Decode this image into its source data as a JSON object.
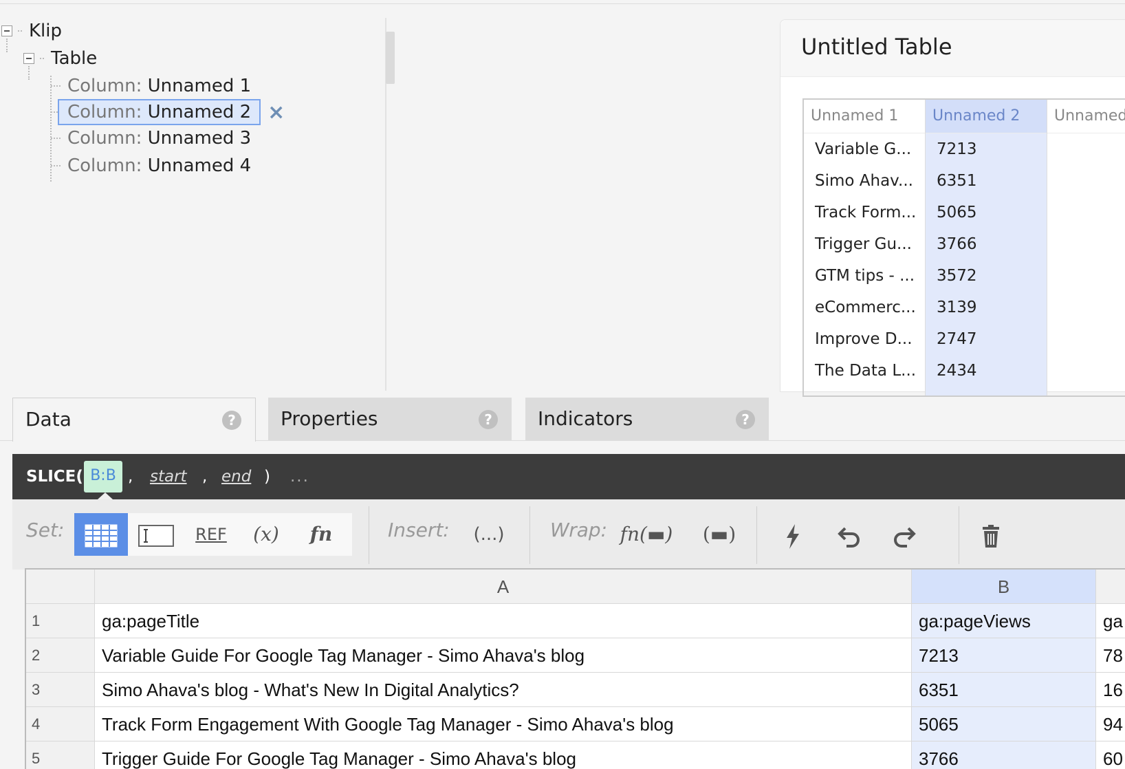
{
  "tree": {
    "root_label": "Klip",
    "table_label": "Table",
    "column_prefix": "Column:",
    "columns": [
      "Unnamed 1",
      "Unnamed 2",
      "Unnamed 3",
      "Unnamed 4"
    ],
    "selected_index": 1,
    "remove_icon": "×"
  },
  "preview": {
    "title": "Untitled Table",
    "headers": [
      "Unnamed 1",
      "Unnamed 2",
      "Unnamed"
    ],
    "col1": [
      "Variable G...",
      "Simo Ahav...",
      "Track Form...",
      "Trigger Gu...",
      "GTM tips - ...",
      "eCommerc...",
      "Improve D...",
      "The Data L..."
    ],
    "col2": [
      "7213",
      "6351",
      "5065",
      "3766",
      "3572",
      "3139",
      "2747",
      "2434"
    ]
  },
  "tabs": [
    {
      "label": "Data",
      "help": "?"
    },
    {
      "label": "Properties",
      "help": "?"
    },
    {
      "label": "Indicators",
      "help": "?"
    }
  ],
  "formula": {
    "fn": "SLICE(",
    "ref": "B:B",
    "comma": ",",
    "arg_start": "start",
    "arg_end": "end",
    "close": ")",
    "more": "..."
  },
  "toolbar": {
    "set_label": "Set:",
    "ref_label": "REF",
    "var_label": "(x)",
    "fn_label": "fn",
    "insert_label": "Insert:",
    "insert_paren": "(...)",
    "wrap_label": "Wrap:",
    "wrap_fn": "fn(▬)",
    "wrap_paren": "(▬)"
  },
  "sheet": {
    "col_headers": [
      "A",
      "B"
    ],
    "rows": [
      {
        "num": "1",
        "a": "ga:pageTitle",
        "b": "ga:pageViews",
        "c": "ga"
      },
      {
        "num": "2",
        "a": "Variable Guide For Google Tag Manager - Simo Ahava's blog",
        "b": "7213",
        "c": "78"
      },
      {
        "num": "3",
        "a": "Simo Ahava's blog - What's New In Digital Analytics?",
        "b": "6351",
        "c": "16"
      },
      {
        "num": "4",
        "a": "Track Form Engagement With Google Tag Manager - Simo Ahava's blog",
        "b": "5065",
        "c": "94"
      },
      {
        "num": "5",
        "a": "Trigger Guide For Google Tag Manager - Simo Ahava's blog",
        "b": "3766",
        "c": "60"
      }
    ]
  },
  "colors": {
    "accent": "#5b8ee6",
    "selection": "#dde8fb",
    "ref_chip": "#c9f0d8",
    "formula_bar": "#3c3c3c"
  }
}
